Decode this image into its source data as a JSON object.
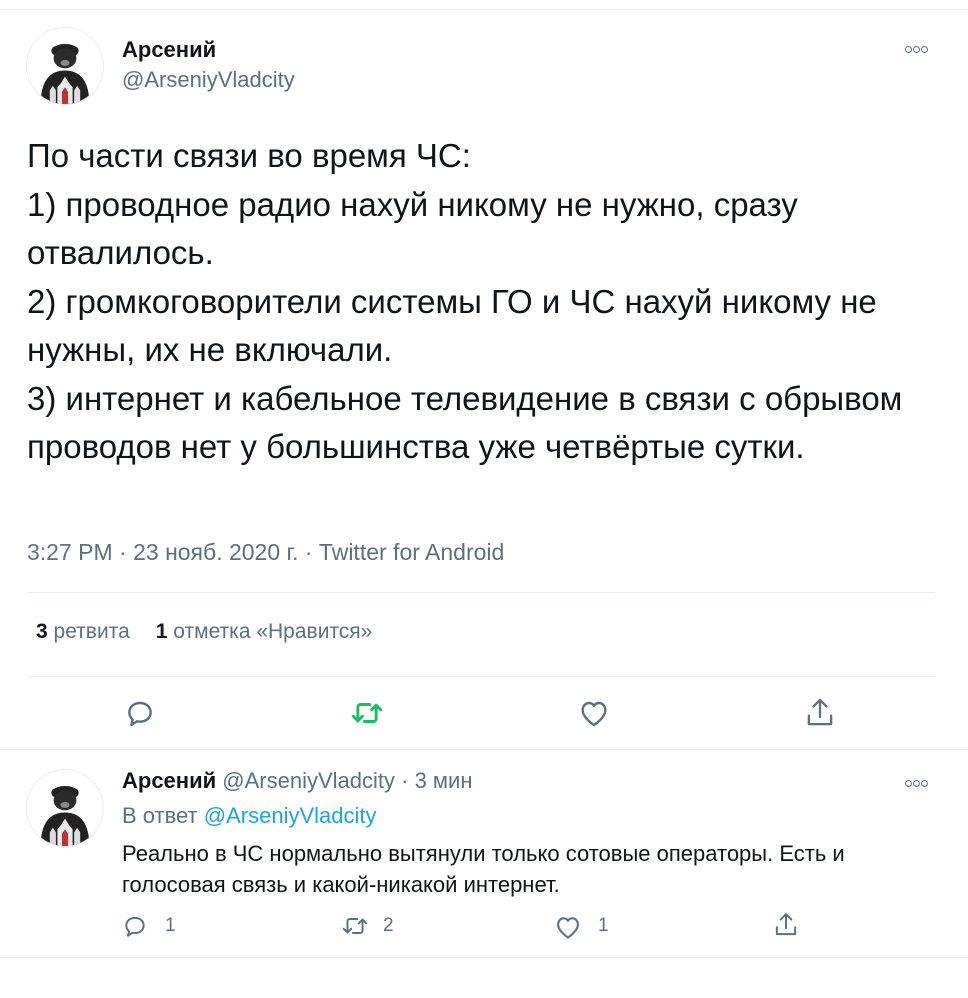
{
  "main_tweet": {
    "author_name": "Арсений",
    "author_handle": "@ArseniyVladcity",
    "text": "По части связи во время ЧС:\n1) проводное радио нахуй никому не нужно, сразу отвалилось.\n2) громкоговорители системы ГО и ЧС нахуй никому не нужны, их не включали.\n3) интернет и кабельное телевидение в связи с обрывом проводов нет у большинства уже четвёртые сутки.",
    "meta": "3:27 PM · 23 нояб. 2020 г. · Twitter for Android",
    "retweet_count": "3",
    "retweet_label": "ретвита",
    "like_count": "1",
    "like_label": "отметка «Нравится»",
    "icons": [
      "more-icon",
      "reply-icon",
      "retweet-icon",
      "like-icon",
      "share-icon"
    ]
  },
  "reply_tweet": {
    "author_name": "Арсений",
    "author_handle": "@ArseniyVladcity",
    "time": "· 3 мин",
    "reply_prefix": "В ответ",
    "reply_handle": "@ArseniyVladcity",
    "text": "Реально в ЧС нормально вытянули только сотовые операторы. Есть и голосовая связь и какой-никакой интернет.",
    "reply_count": "1",
    "retweet_count": "2",
    "like_count": "1"
  },
  "colors": {
    "accent": "#1da1f2",
    "retweet_green": "#17bf63",
    "secondary_text": "#5b7083",
    "divider": "#e6ecf0"
  }
}
